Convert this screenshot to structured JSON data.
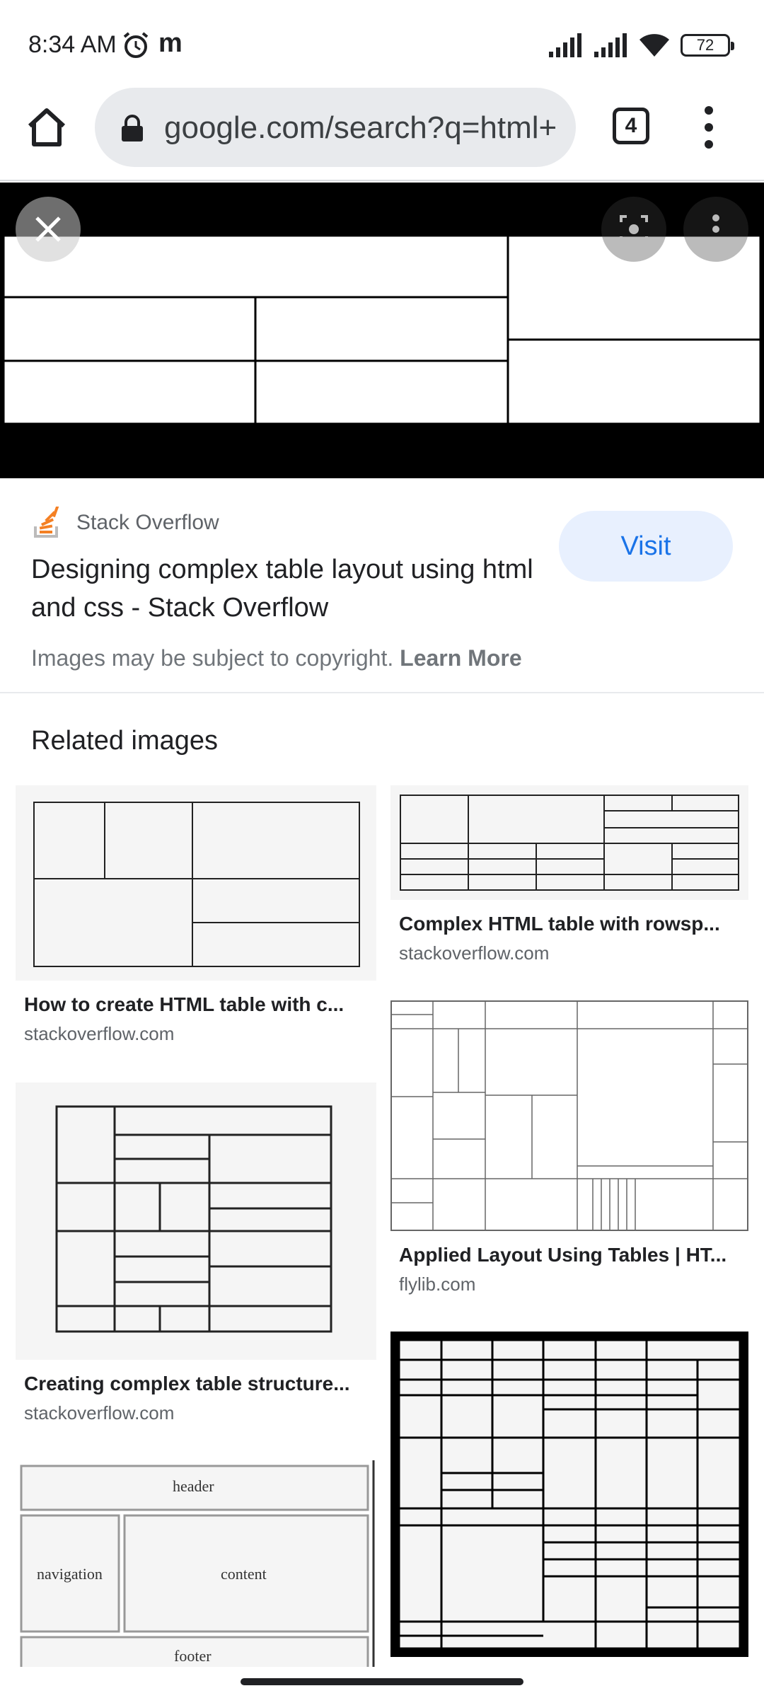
{
  "status_bar": {
    "time": "8:34 AM",
    "battery": "72",
    "app_indicator": "m"
  },
  "browser": {
    "url": "google.com/search?q=html+",
    "tab_count": "4"
  },
  "result": {
    "source_name": "Stack Overflow",
    "visit_label": "Visit",
    "title": "Designing complex table layout using html and css - Stack Overflow",
    "copyright_text": "Images may be subject to copyright.",
    "learn_more": "Learn More"
  },
  "related": {
    "heading": "Related images",
    "items": [
      {
        "title": "How to create HTML table with c...",
        "source": "stackoverflow.com"
      },
      {
        "title": "Complex HTML table with rowsp...",
        "source": "stackoverflow.com"
      },
      {
        "title": "Applied Layout Using Tables | HT...",
        "source": "flylib.com"
      },
      {
        "title": "Creating complex table structure...",
        "source": "stackoverflow.com"
      },
      {
        "header": "header",
        "navigation": "navigation",
        "content": "content",
        "footer": "footer"
      }
    ]
  },
  "icons": {
    "home": "home-icon",
    "lock": "lock-icon",
    "menu": "more-vert-icon",
    "close": "close-icon",
    "lens": "lens-icon",
    "alarm": "alarm-icon"
  },
  "colors": {
    "visit_bg": "#e8f0fe",
    "visit_text": "#1a73e8",
    "so_orange": "#f48024"
  }
}
